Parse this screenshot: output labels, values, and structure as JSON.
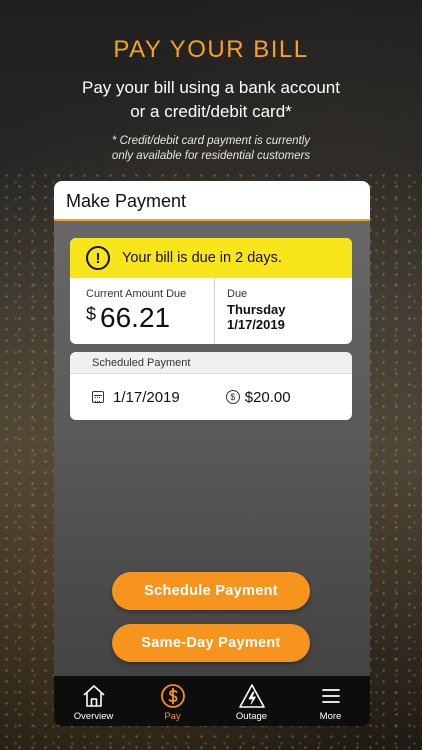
{
  "header": {
    "title": "PAY YOUR BILL",
    "subtitle_line1": "Pay your bill using a bank account",
    "subtitle_line2": "or a credit/debit card*",
    "note_line1": "* Credit/debit card payment is currently",
    "note_line2": "only available for residential customers"
  },
  "screen": {
    "title": "Make Payment"
  },
  "due_notice": {
    "icon": "warning-icon",
    "text": "Your bill is due in 2 days."
  },
  "amount_due": {
    "label": "Current Amount Due",
    "currency": "$",
    "value": "66.21"
  },
  "due": {
    "label": "Due",
    "day": "Thursday",
    "date": "1/17/2019"
  },
  "scheduled_payment": {
    "header": "Scheduled Payment",
    "date": "1/17/2019",
    "date_icon": "calendar-icon",
    "amount": "$20.00",
    "amount_icon": "dollar-coin-icon"
  },
  "buttons": {
    "schedule": "Schedule Payment",
    "same_day": "Same-Day Payment"
  },
  "tabs": [
    {
      "label": "Overview",
      "icon": "home-icon"
    },
    {
      "label": "Pay",
      "icon": "dollar-circle-icon",
      "active": true
    },
    {
      "label": "Outage",
      "icon": "lightning-warning-icon"
    },
    {
      "label": "More",
      "icon": "menu-icon"
    }
  ],
  "colors": {
    "accent": "#f7941d",
    "title_orange": "#f7a21b",
    "notice_yellow": "#f9e61a",
    "tabbar": "#0d0d0d"
  }
}
